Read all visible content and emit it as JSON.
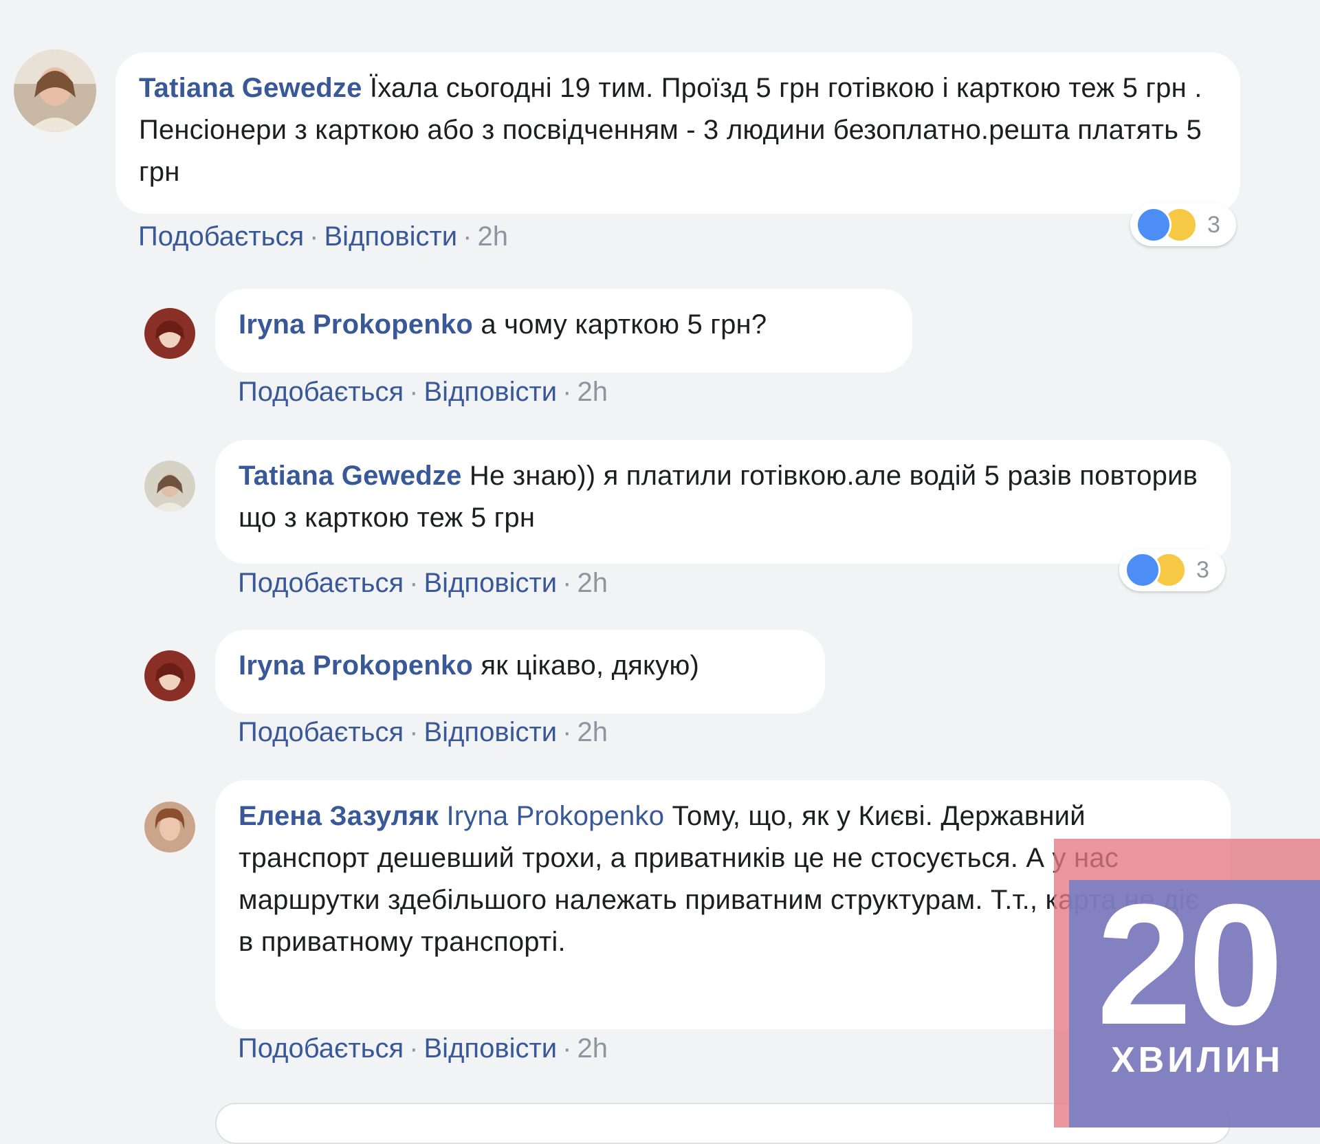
{
  "comments": [
    {
      "author": "Tatiana Gewedze",
      "text": "Їхала сьогодні 19 тим. Проїзд 5 грн готівкою і карткою теж 5 грн . Пенсіонери з карткою або з посвідченням - 3 людини безоплатно.решта платять 5 грн",
      "like": "Подобається",
      "reply": "Відповісти",
      "time": "2h",
      "reactions_count": "3"
    },
    {
      "author": "Iryna Prokopenko",
      "text": "а чому карткою 5 грн?",
      "like": "Подобається",
      "reply": "Відповісти",
      "time": "2h"
    },
    {
      "author": "Tatiana Gewedze",
      "text": "Не знаю)) я платили готівкою.але водій 5 разів повторив що з карткою теж 5 грн",
      "like": "Подобається",
      "reply": "Відповісти",
      "time": "2h",
      "reactions_count": "3"
    },
    {
      "author": "Iryna Prokopenko",
      "text": "як цікаво, дякую)",
      "like": "Подобається",
      "reply": "Відповісти",
      "time": "2h"
    },
    {
      "author": "Елена Зазуляк",
      "mention": "Iryna Prokopenko",
      "text": "Тому, що, як у Києві. Державний транспорт дешевший трохи, а приватників це не стосується. А у нас маршрутки здебільшого належать приватним структурам. Т.т., карта не діє в приватному транспорті.",
      "like": "Подобається",
      "reply": "Відповісти",
      "time": "2h"
    }
  ],
  "watermark": {
    "number": "20",
    "word": "ХВИЛИН"
  },
  "colors": {
    "author": "#385898",
    "background": "#f2f3f5",
    "bubble": "#ffffff",
    "meta": "#90949c"
  }
}
